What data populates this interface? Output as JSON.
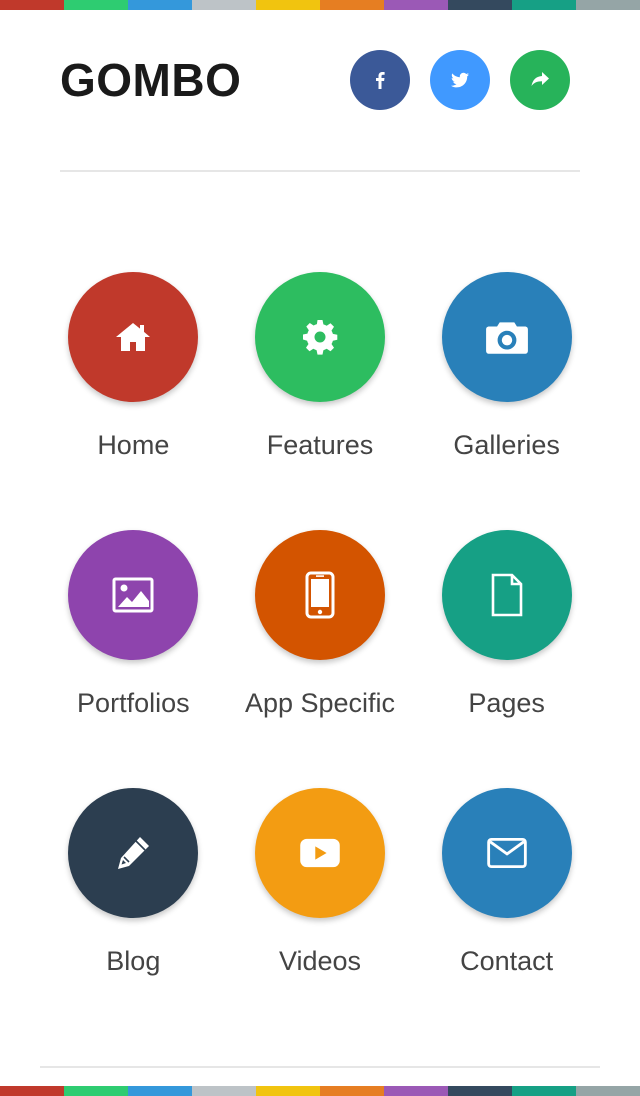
{
  "brand": {
    "title": "GOMBO"
  },
  "colors": {
    "stripe": [
      "#c0392b",
      "#2ecc71",
      "#3498db",
      "#bdc3c7",
      "#f1c40f",
      "#e67e22",
      "#9b59b6",
      "#34495e",
      "#16a085",
      "#95a5a6"
    ],
    "text": "#444444",
    "logo": "#1a1a1a"
  },
  "social": [
    {
      "name": "facebook",
      "icon": "facebook-icon",
      "color": "#3b5998"
    },
    {
      "name": "twitter",
      "icon": "twitter-icon",
      "color": "#4099ff"
    },
    {
      "name": "share",
      "icon": "share-icon",
      "color": "#27b35a"
    }
  ],
  "menu": [
    {
      "label": "Home",
      "icon": "home-icon",
      "color": "#c0392b"
    },
    {
      "label": "Features",
      "icon": "gear-icon",
      "color": "#2dbd60"
    },
    {
      "label": "Galleries",
      "icon": "camera-icon",
      "color": "#2980b9"
    },
    {
      "label": "Portfolios",
      "icon": "image-icon",
      "color": "#8e44ad"
    },
    {
      "label": "App Specific",
      "icon": "mobile-icon",
      "color": "#d35400"
    },
    {
      "label": "Pages",
      "icon": "file-icon",
      "color": "#16a085"
    },
    {
      "label": "Blog",
      "icon": "pencil-icon",
      "color": "#2c3e50"
    },
    {
      "label": "Videos",
      "icon": "youtube-icon",
      "color": "#f39c12"
    },
    {
      "label": "Contact",
      "icon": "envelope-icon",
      "color": "#2980b9"
    }
  ]
}
